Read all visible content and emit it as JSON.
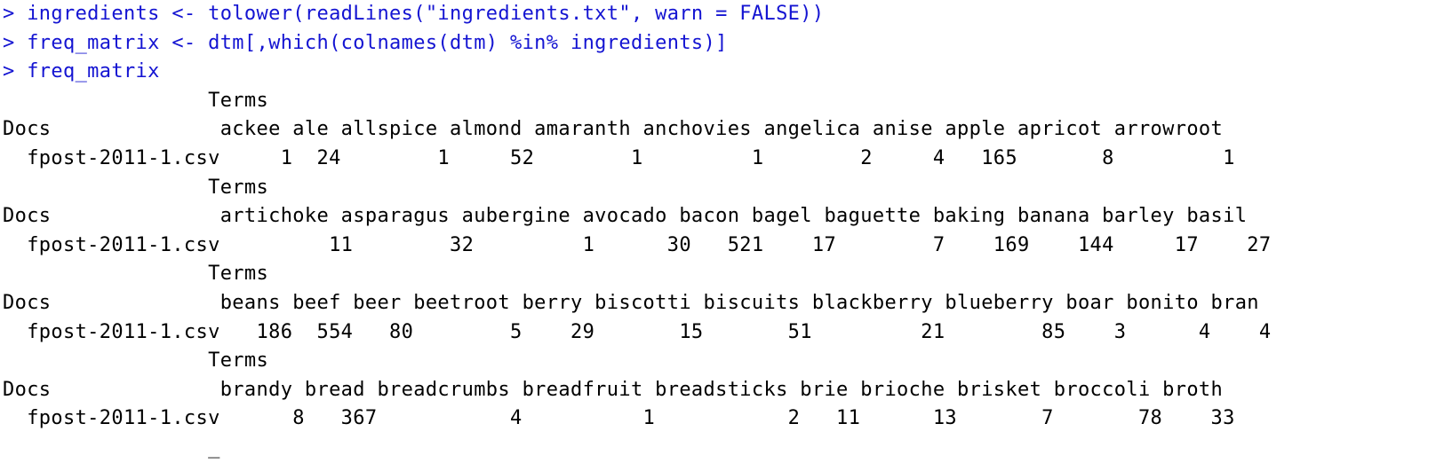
{
  "console": {
    "commands": [
      "> ingredients <- tolower(readLines(\"ingredients.txt\", warn = FALSE))",
      "> freq_matrix <- dtm[,which(colnames(dtm) %in% ingredients)]",
      "> freq_matrix"
    ],
    "blocks": [
      {
        "terms_header": "                 Terms",
        "docs_header": "Docs              ackee ale allspice almond amaranth anchovies angelica anise apple apricot arrowroot",
        "row": "  fpost-2011-1.csv     1  24        1     52        1         1        2     4   165       8         1"
      },
      {
        "terms_header": "                 Terms",
        "docs_header": "Docs              artichoke asparagus aubergine avocado bacon bagel baguette baking banana barley basil",
        "row": "  fpost-2011-1.csv         11        32         1      30   521    17        7    169    144     17    27"
      },
      {
        "terms_header": "                 Terms",
        "docs_header": "Docs              beans beef beer beetroot berry biscotti biscuits blackberry blueberry boar bonito bran",
        "row": "  fpost-2011-1.csv   186  554   80        5    29       15       51         21        85    3      4    4"
      },
      {
        "terms_header": "                 Terms",
        "docs_header": "Docs              brandy bread breadcrumbs breadfruit breadsticks brie brioche brisket broccoli broth",
        "row": "  fpost-2011-1.csv      8   367           4          1           2   11      13       7       78    33"
      }
    ],
    "cursor": "                 _"
  }
}
